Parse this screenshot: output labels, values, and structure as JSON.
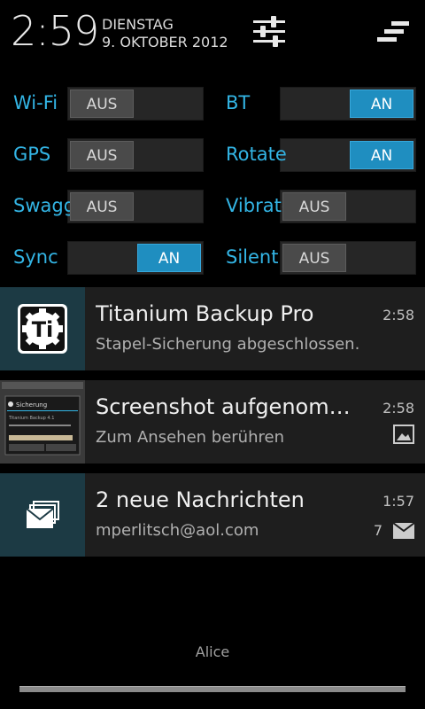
{
  "header": {
    "time": "2:59",
    "day": "DIENSTAG",
    "date": "9. OKTOBER 2012",
    "settings_icon": "settings-sliders-icon",
    "clear_icon": "clear-all-icon"
  },
  "toggles": [
    {
      "label": "Wi-Fi",
      "state": "AUS"
    },
    {
      "label": "BT",
      "state": "AN"
    },
    {
      "label": "GPS",
      "state": "AUS"
    },
    {
      "label": "Rotate",
      "state": "AN"
    },
    {
      "label": "Swagger",
      "state": "AUS"
    },
    {
      "label": "Vibrate",
      "state": "AUS"
    },
    {
      "label": "Sync",
      "state": "AN"
    },
    {
      "label": "Silent",
      "state": "AUS"
    }
  ],
  "notifications": [
    {
      "title": "Titanium Backup Pro",
      "text": "Stapel-Sicherung abgeschlossen.",
      "time": "2:58",
      "icon": "titanium-backup-icon"
    },
    {
      "title": "Screenshot aufgenommen.",
      "text": "Zum Ansehen berühren",
      "time": "2:58",
      "icon": "screenshot-thumbnail",
      "small_icon": "image-icon",
      "thumb_text": [
        "Sicherung",
        "Titanium Backup 4.1"
      ]
    },
    {
      "title": "2 neue Nachrichten",
      "text": "mperlitsch@aol.com",
      "time": "1:57",
      "count": "7",
      "icon": "email-stack-icon",
      "small_icon": "envelope-icon"
    }
  ],
  "footer": {
    "carrier": "Alice"
  },
  "colors": {
    "accent": "#33b5e5",
    "on": "#1f8ec0",
    "notification_bg": "#1e1e1e",
    "icon_bg": "#1c3a44"
  }
}
